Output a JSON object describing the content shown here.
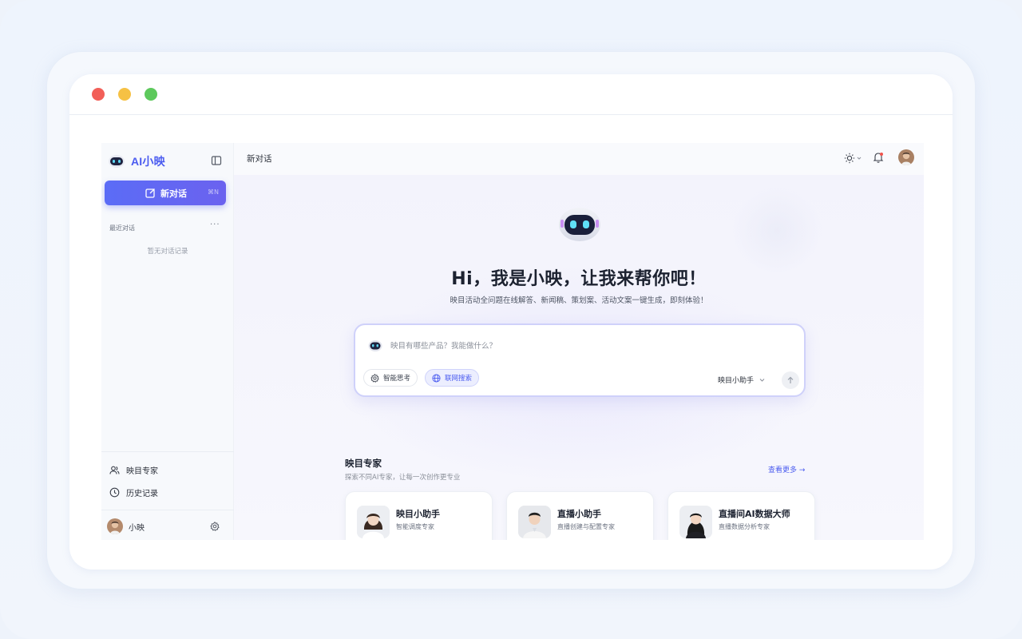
{
  "app": {
    "logo_text": "AI小映",
    "new_chat_label": "新对话",
    "new_chat_shortcut": "⌘N"
  },
  "sidebar": {
    "recent_title": "最近对话",
    "recent_more": "···",
    "empty_text": "暂无对话记录",
    "nav_items": [
      {
        "label": "映目专家",
        "icon": "users-icon"
      },
      {
        "label": "历史记录",
        "icon": "clock-icon"
      }
    ],
    "user_name": "小映"
  },
  "topbar": {
    "title": "新对话"
  },
  "hero": {
    "title": "Hi，我是小映，让我来帮你吧！",
    "subtitle": "映目活动全问题在线解答、新闻稿、策划案、活动文案一键生成，即刻体验！"
  },
  "input": {
    "placeholder": "映目有哪些产品？我能做什么？",
    "value": "",
    "chips": [
      {
        "label": "智能思考",
        "icon": "gear-icon",
        "active": false
      },
      {
        "label": "联网搜索",
        "icon": "globe-icon",
        "active": true
      }
    ],
    "model": "映目小助手"
  },
  "experts": {
    "title": "映目专家",
    "subtitle": "探索不同AI专家，让每一次创作更专业",
    "see_more": "查看更多 →",
    "cards": [
      {
        "name": "映目小助手",
        "desc": "智能调度专家"
      },
      {
        "name": "直播小助手",
        "desc": "直播创建与配置专家"
      },
      {
        "name": "直播间AI数据大师",
        "desc": "直播数据分析专家"
      }
    ]
  },
  "colors": {
    "accent": "#5b6cf6",
    "accent_text": "#4b5cf0",
    "notification_dot": "#f0534c"
  }
}
